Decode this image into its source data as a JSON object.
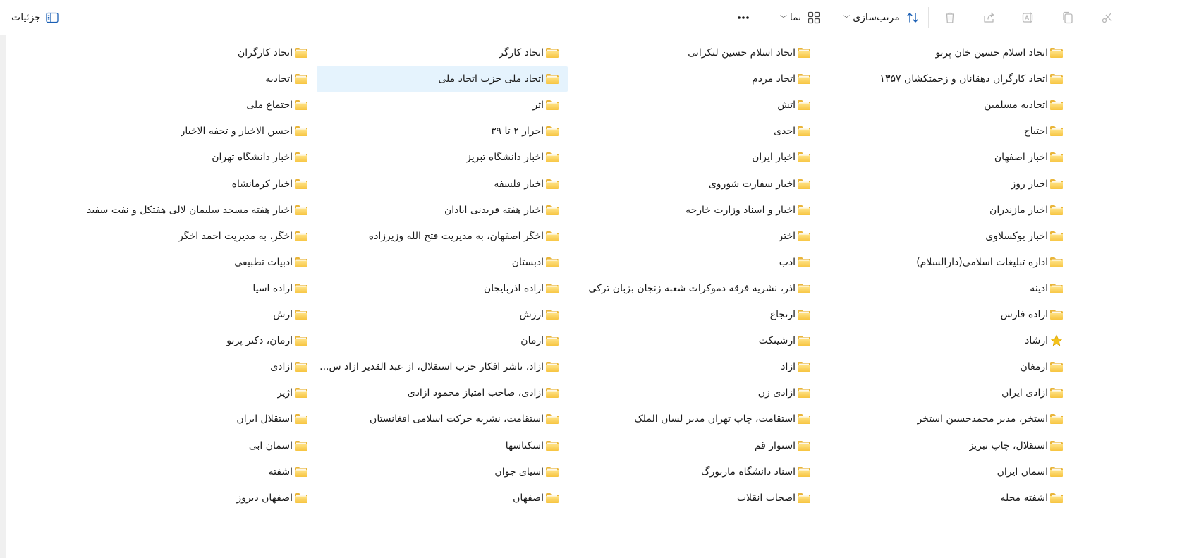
{
  "toolbar": {
    "details_label": "جزئیات",
    "view_label": "نما",
    "sort_label": "مرتب‌سازی",
    "more_label": "···"
  },
  "columns": [
    {
      "items": [
        {
          "label": "اتحاد اسلام حسین خان پرتو",
          "icon": "folder-icon"
        },
        {
          "label": "اتحاد کارگران دهقانان و زحمتکشان ۱۳۵۷",
          "icon": "folder-icon"
        },
        {
          "label": "اتحادیه مسلمین",
          "icon": "folder-icon"
        },
        {
          "label": "احتیاج",
          "icon": "folder-icon"
        },
        {
          "label": "اخبار اصفهان",
          "icon": "folder-icon"
        },
        {
          "label": "اخبار روز",
          "icon": "folder-icon"
        },
        {
          "label": "اخبار مازندران",
          "icon": "folder-icon"
        },
        {
          "label": "اخبار یوکسلاوی",
          "icon": "folder-icon"
        },
        {
          "label": "اداره تبلیغات اسلامی(دارالسلام)",
          "icon": "folder-icon"
        },
        {
          "label": "ادینه",
          "icon": "folder-icon"
        },
        {
          "label": "اراده فارس",
          "icon": "folder-icon"
        },
        {
          "label": "ارشاد",
          "icon": "star-icon"
        },
        {
          "label": "ارمغان",
          "icon": "folder-icon"
        },
        {
          "label": "ازادی ایران",
          "icon": "folder-icon"
        },
        {
          "label": "استخر، مدیر محمدحسین استخر",
          "icon": "folder-icon"
        },
        {
          "label": "استقلال، چاپ تبریز",
          "icon": "folder-icon"
        },
        {
          "label": "اسمان ایران",
          "icon": "folder-icon"
        },
        {
          "label": "اشفته مجله",
          "icon": "folder-icon"
        }
      ]
    },
    {
      "items": [
        {
          "label": "اتحاد اسلام حسین لنکرانی",
          "icon": "folder-icon"
        },
        {
          "label": "اتحاد مردم",
          "icon": "folder-icon"
        },
        {
          "label": "اتش",
          "icon": "folder-icon"
        },
        {
          "label": "احدی",
          "icon": "folder-icon"
        },
        {
          "label": "اخبار ایران",
          "icon": "folder-icon"
        },
        {
          "label": "اخبار سفارت شوروی",
          "icon": "folder-icon"
        },
        {
          "label": "اخبار و اسناد وزارت خارجه",
          "icon": "folder-icon"
        },
        {
          "label": "اختر",
          "icon": "folder-icon"
        },
        {
          "label": "ادب",
          "icon": "folder-icon"
        },
        {
          "label": "اذر، نشریه فرقه دموکرات شعبه زنجان بزبان ترکی",
          "icon": "folder-icon"
        },
        {
          "label": "ارتجاع",
          "icon": "folder-icon"
        },
        {
          "label": "ارشیتکت",
          "icon": "folder-icon"
        },
        {
          "label": "ازاد",
          "icon": "folder-icon"
        },
        {
          "label": "ازادی زن",
          "icon": "folder-icon"
        },
        {
          "label": "استقامت، چاپ تهران مدیر لسان الملک",
          "icon": "folder-icon"
        },
        {
          "label": "استوار قم",
          "icon": "folder-icon"
        },
        {
          "label": "اسناد دانشگاه ماربورگ",
          "icon": "folder-icon"
        },
        {
          "label": "اصحاب انقلاب",
          "icon": "folder-icon"
        }
      ]
    },
    {
      "items": [
        {
          "label": "اتحاد کارگر",
          "icon": "folder-icon"
        },
        {
          "label": "اتحاد ملی حزب اتحاد ملی",
          "icon": "folder-icon",
          "selected": true
        },
        {
          "label": "اثر",
          "icon": "folder-icon"
        },
        {
          "label": "احرار ۲ تا ۳۹",
          "icon": "folder-icon"
        },
        {
          "label": "اخبار دانشگاه تبریز",
          "icon": "folder-icon"
        },
        {
          "label": "اخبار فلسفه",
          "icon": "folder-icon"
        },
        {
          "label": "اخبار هفته فریدنی ابادان",
          "icon": "folder-icon"
        },
        {
          "label": "اخگر اصفهان، به مدیریت فتح الله وزیرزاده",
          "icon": "folder-icon"
        },
        {
          "label": "ادبستان",
          "icon": "folder-icon"
        },
        {
          "label": "اراده اذربایجان",
          "icon": "folder-icon"
        },
        {
          "label": "ارزش",
          "icon": "folder-icon"
        },
        {
          "label": "ارمان",
          "icon": "folder-icon"
        },
        {
          "label": "ازاد، ناشر افکار حزب استقلال، از عبد القدیر ازاد س...",
          "icon": "folder-icon"
        },
        {
          "label": "ازادی، صاحب امتیاز محمود ازادی",
          "icon": "folder-icon"
        },
        {
          "label": "استقامت، نشریه حرکت اسلامی افغانستان",
          "icon": "folder-icon"
        },
        {
          "label": "اسکناسها",
          "icon": "folder-icon"
        },
        {
          "label": "اسیای جوان",
          "icon": "folder-icon"
        },
        {
          "label": "اصفهان",
          "icon": "folder-icon"
        }
      ]
    },
    {
      "items": [
        {
          "label": "اتحاد کارگران",
          "icon": "folder-icon"
        },
        {
          "label": "اتحادیه",
          "icon": "folder-icon"
        },
        {
          "label": "اجتماع ملی",
          "icon": "folder-icon"
        },
        {
          "label": "احسن الاخبار و تحفه الاخبار",
          "icon": "folder-icon"
        },
        {
          "label": "اخبار دانشگاه تهران",
          "icon": "folder-icon"
        },
        {
          "label": "اخبار کرمانشاه",
          "icon": "folder-icon"
        },
        {
          "label": "اخبار هفته مسجد سلیمان لالی هفتکل و نفت سفید",
          "icon": "folder-icon"
        },
        {
          "label": "اخگر، به مدیریت احمد اخگر",
          "icon": "folder-icon"
        },
        {
          "label": "ادبیات تطبیقی",
          "icon": "folder-icon"
        },
        {
          "label": "اراده اسیا",
          "icon": "folder-icon"
        },
        {
          "label": "ارش",
          "icon": "folder-icon"
        },
        {
          "label": "ارمان، دکتر پرتو",
          "icon": "folder-icon"
        },
        {
          "label": "ازادی",
          "icon": "folder-icon"
        },
        {
          "label": "اژیر",
          "icon": "folder-icon"
        },
        {
          "label": "استقلال ایران",
          "icon": "folder-icon"
        },
        {
          "label": "اسمان ابی",
          "icon": "folder-icon"
        },
        {
          "label": "اشفته",
          "icon": "folder-icon"
        },
        {
          "label": "اصفهان دیروز",
          "icon": "folder-icon"
        }
      ]
    }
  ]
}
